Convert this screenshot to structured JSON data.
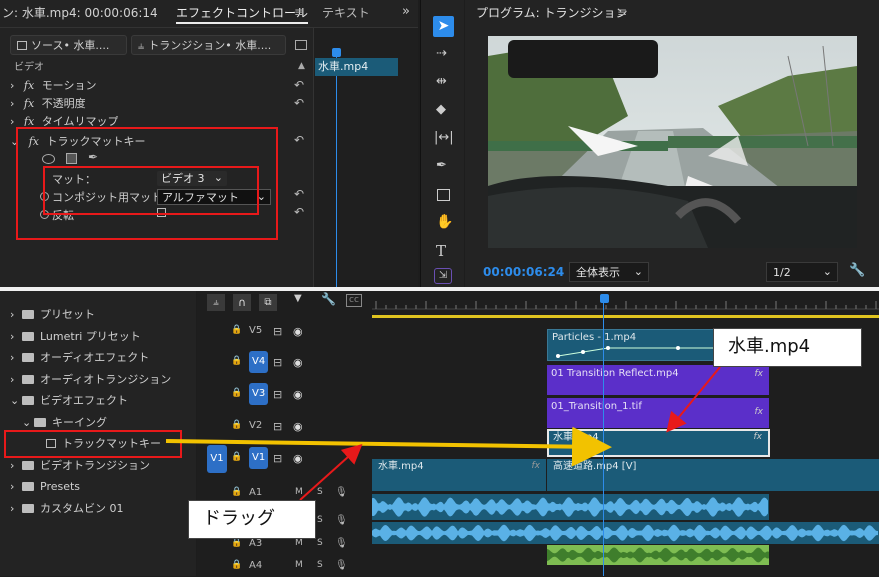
{
  "effect_controls": {
    "source_tab": "ン: 水車.mp4: 00:00:06:14",
    "active_tab": "エフェクトコントロール",
    "menu_icon": "hamburger-icon",
    "other_tab": "テキスト",
    "expand_icon": "double-chevron-right-icon",
    "source_btn": "ソース• 水車....",
    "transition_btn": "トランジション• 水車....",
    "section_video": "ビデオ",
    "clip_name": "水車.mp4",
    "effects": [
      "モーション",
      "不透明度",
      "タイムリマップ",
      "トラックマットキー"
    ],
    "matte_label": "マット：",
    "matte_value": "ビデオ 3",
    "composite_label": "コンポジット用マット：",
    "composite_value": "アルファマット",
    "reverse_label": "反転"
  },
  "program": {
    "title": "プログラム: トランジション",
    "menu_icon": "hamburger-icon",
    "timecode": "00:00:06:24",
    "fit_select": "全体表示",
    "res_select": "1/2",
    "wrench_icon": "wrench-icon"
  },
  "tools": [
    "selection-arrow-icon",
    "track-select-icon",
    "ripple-edit-icon",
    "razor-icon",
    "slip-icon",
    "pen-icon",
    "rectangle-icon",
    "hand-icon",
    "type-icon",
    "remix-icon"
  ],
  "effects_panel": {
    "items": [
      {
        "label": "プリセット",
        "icon": "folder-star-icon",
        "indent": 0,
        "expanded": false
      },
      {
        "label": "Lumetri プリセット",
        "icon": "folder-star-icon",
        "indent": 0,
        "expanded": false
      },
      {
        "label": "オーディオエフェクト",
        "icon": "folder-icon",
        "indent": 0,
        "expanded": false
      },
      {
        "label": "オーディオトランジション",
        "icon": "folder-icon",
        "indent": 0,
        "expanded": false
      },
      {
        "label": "ビデオエフェクト",
        "icon": "folder-icon",
        "indent": 0,
        "expanded": true
      },
      {
        "label": "キーイング",
        "icon": "folder-icon",
        "indent": 1,
        "expanded": true
      },
      {
        "label": "トラックマットキー",
        "icon": "effect-icon",
        "indent": 2,
        "expanded": null
      },
      {
        "label": "ビデオトランジション",
        "icon": "folder-icon",
        "indent": 0,
        "expanded": false
      },
      {
        "label": "Presets",
        "icon": "folder-icon",
        "indent": 0,
        "expanded": false
      },
      {
        "label": "カスタムビン 01",
        "icon": "folder-icon",
        "indent": 0,
        "expanded": false
      }
    ]
  },
  "timeline": {
    "tracks": [
      {
        "name": "V5",
        "target": false
      },
      {
        "name": "V4",
        "target": true
      },
      {
        "name": "V3",
        "target": true
      },
      {
        "name": "V2",
        "target": false
      },
      {
        "name": "V1",
        "target": true,
        "source": "V1"
      },
      {
        "name": "A1",
        "m": "M",
        "s": "S"
      },
      {
        "name": "A2",
        "m": "M",
        "s": "S"
      },
      {
        "name": "A3",
        "m": "M",
        "s": "S"
      },
      {
        "name": "A4",
        "m": "M",
        "s": "S"
      }
    ],
    "clips": {
      "particles": "Particles - 1.mp4",
      "reflect": "01 Transition Reflect.mp4",
      "transition1": "01_Transition_1.tif",
      "v2_clip": "水車.mp4",
      "v1_left": "水車.mp4",
      "v1_right": "高速道路.mp4 [V]",
      "fx": "fx"
    }
  },
  "annotations": {
    "callout_clip": "水車.mp4",
    "callout_drag": "ドラッグ"
  },
  "colors": {
    "accent_blue": "#2d8ceb",
    "clip_purple": "#5b2fc9",
    "clip_teal": "#1b5b78",
    "audio_green": "#7ebd52",
    "arrow_yellow": "#f2c200",
    "annotation_red": "#e8191a"
  }
}
